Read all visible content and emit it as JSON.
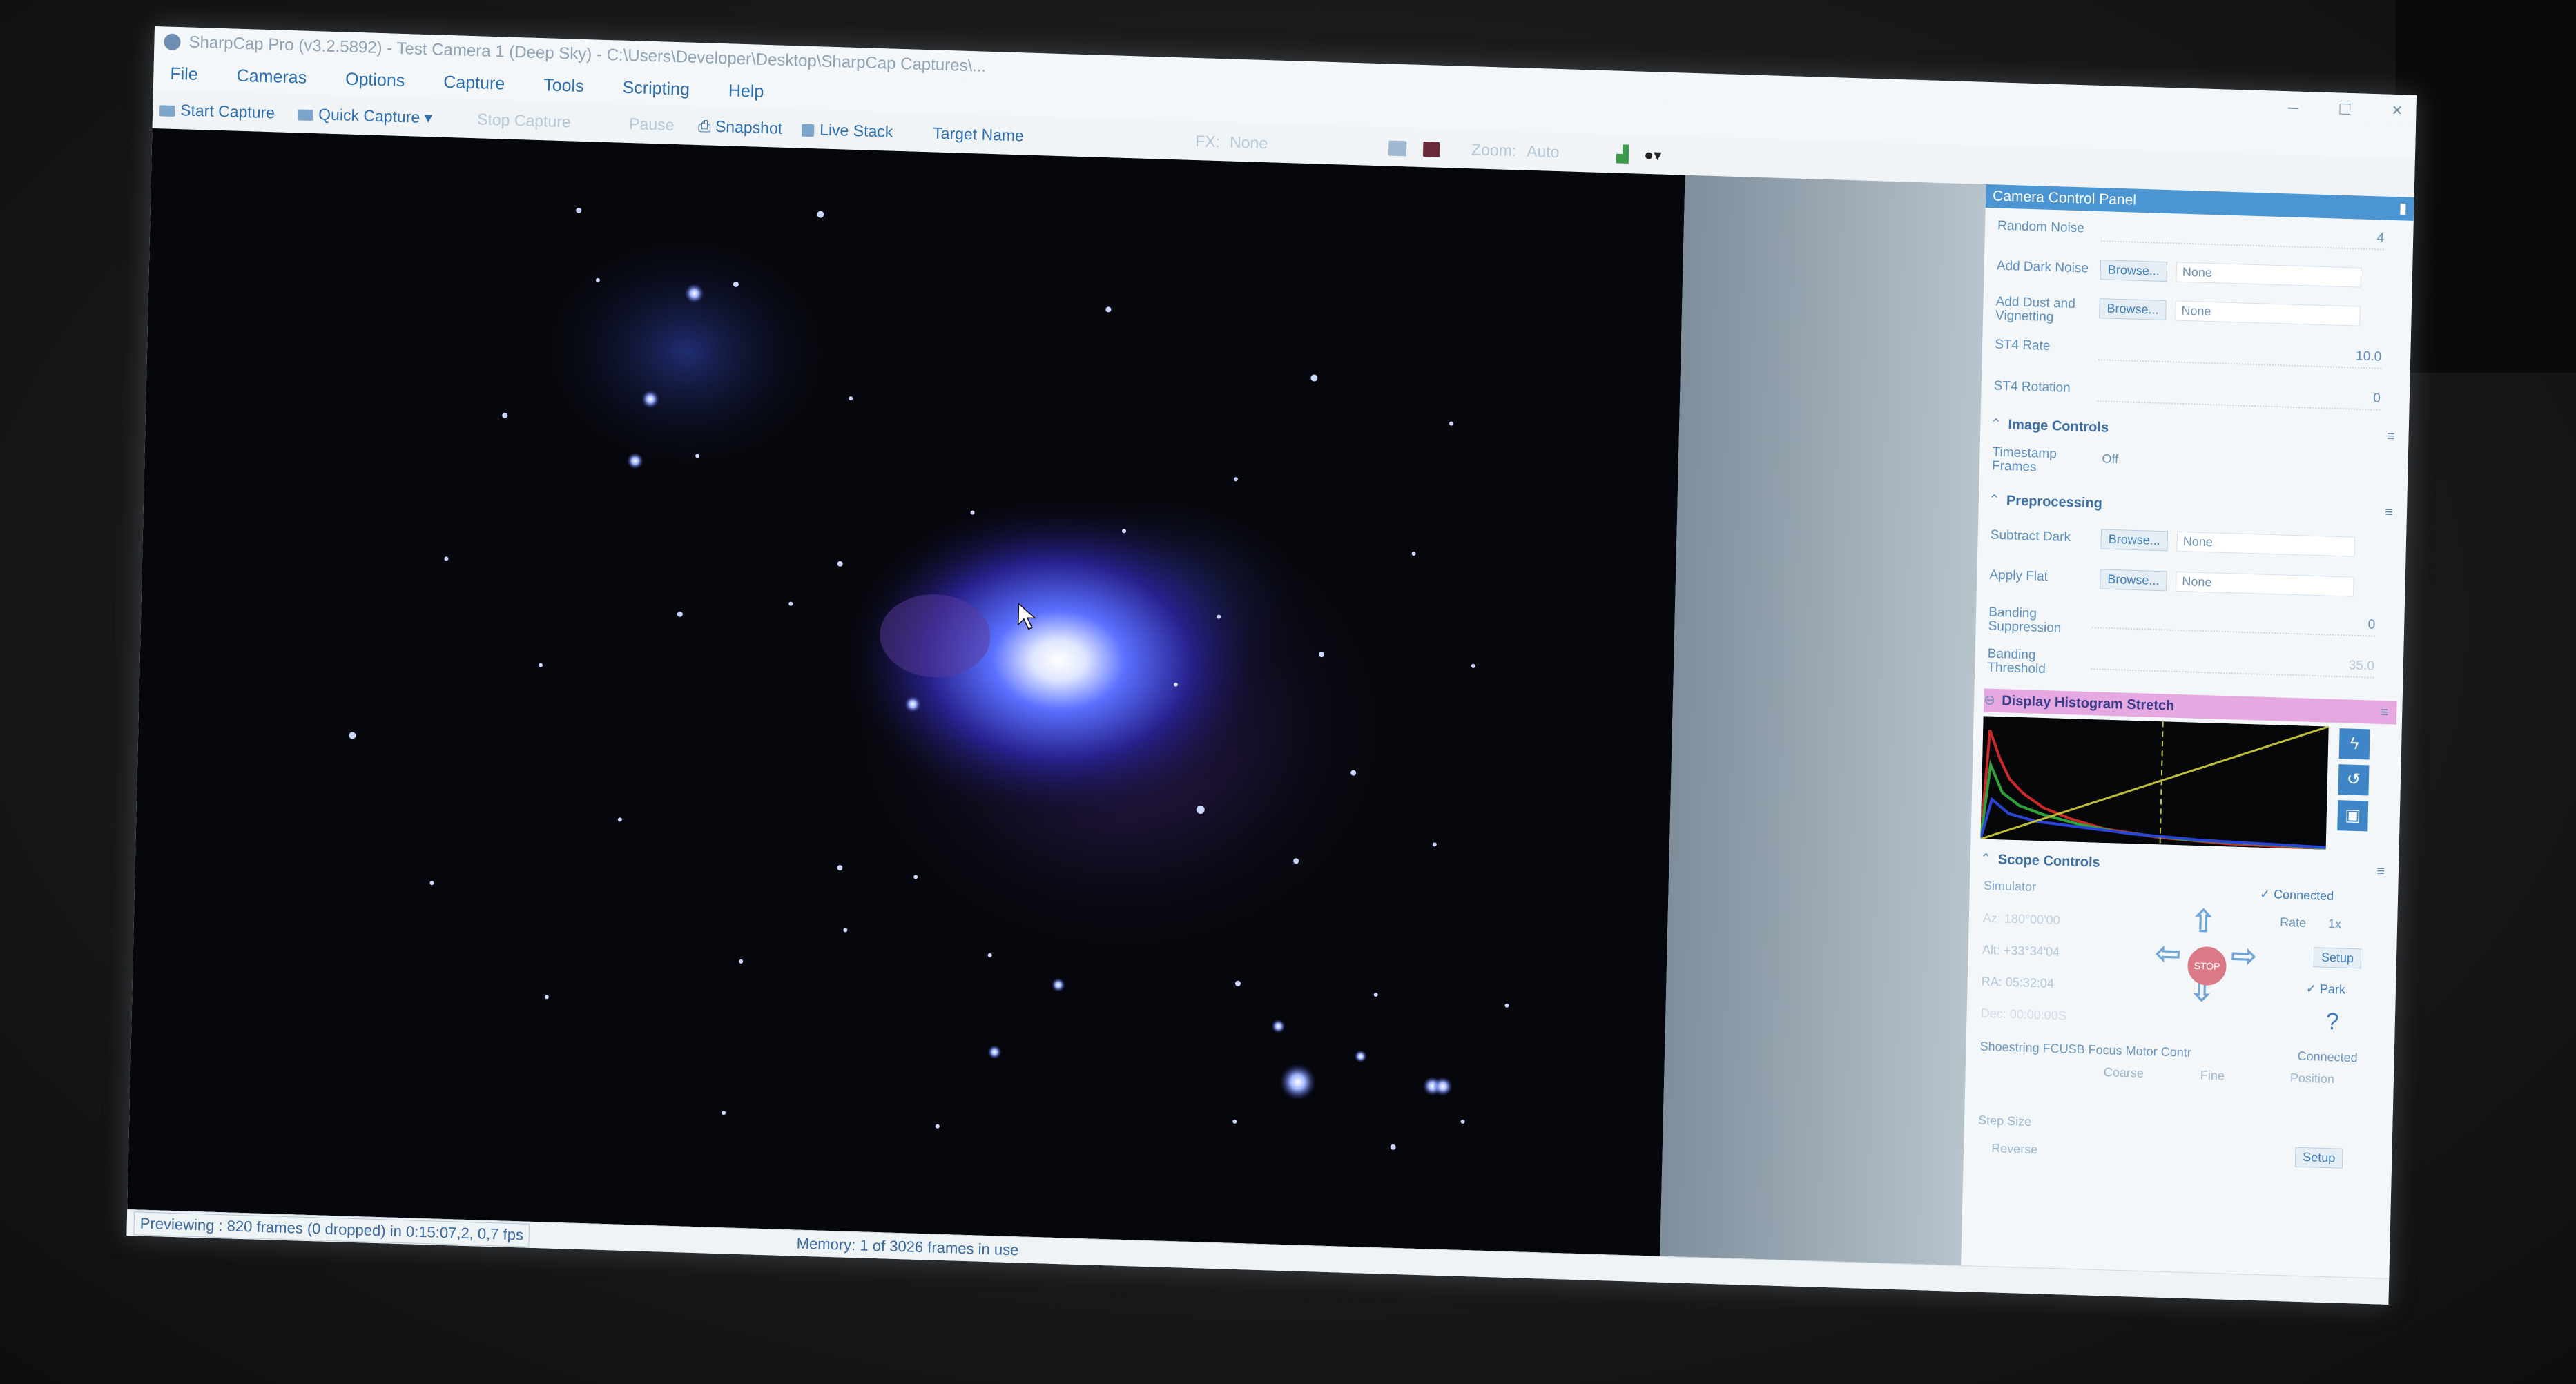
{
  "window": {
    "title": "SharpCap Pro (v3.2.5892) - Test Camera 1 (Deep Sky) - C:\\Users\\Developer\\Desktop\\SharpCap Captures\\...",
    "minimize_label": "–",
    "maximize_label": "□",
    "close_label": "×"
  },
  "menu": [
    "File",
    "Cameras",
    "Options",
    "Capture",
    "Tools",
    "Scripting",
    "Help"
  ],
  "toolbar": {
    "start_capture": "Start Capture",
    "quick_capture": "Quick Capture",
    "stop_capture": "Stop Capture",
    "pause": "Pause",
    "snapshot": "Snapshot",
    "live_stack": "Live Stack",
    "target_name": "Target Name",
    "fx_label": "FX:",
    "fx_value": "None",
    "zoom_label": "Zoom:",
    "zoom_value": "Auto"
  },
  "side_panel": {
    "title": "Camera Control Panel",
    "random_noise": {
      "label": "Random Noise",
      "value": "4"
    },
    "add_dark_noise": {
      "label": "Add Dark Noise",
      "browse": "Browse...",
      "value": "None"
    },
    "add_dust": {
      "label": "Add Dust and Vignetting",
      "browse": "Browse...",
      "value": "None"
    },
    "st4_rate": {
      "label": "ST4 Rate",
      "value": "10.0"
    },
    "st4_rotation": {
      "label": "ST4 Rotation",
      "value": "0"
    },
    "image_controls": {
      "title": "Image Controls",
      "timestamp_label": "Timestamp Frames",
      "timestamp_value": "Off"
    },
    "preprocessing": {
      "title": "Preprocessing",
      "subtract_dark_label": "Subtract Dark",
      "subtract_dark_browse": "Browse...",
      "subtract_dark_value": "None",
      "apply_flat_label": "Apply Flat",
      "apply_flat_browse": "Browse...",
      "apply_flat_value": "None",
      "banding_suppression_label": "Banding Suppression",
      "banding_suppression_value": "0",
      "banding_threshold_label": "Banding Threshold",
      "banding_threshold_value": "35.0"
    },
    "histogram": {
      "title": "Display Histogram Stretch"
    },
    "scope": {
      "title": "Scope Controls",
      "driver": "Simulator",
      "connected": "Connected",
      "az": "Az:  180°00'00",
      "alt": "Alt:  +33°34'04",
      "ra": "RA:  05:32:04",
      "dec": "Dec:  00:00:00S",
      "rate_label": "Rate",
      "rate_value": "1x",
      "setup": "Setup",
      "park": "Park",
      "stop": "STOP",
      "help": "?",
      "focuser": "Shoestring FCUSB Focus Motor Contr",
      "focuser_connected": "Connected",
      "coarse": "Coarse",
      "fine": "Fine",
      "position": "Position",
      "step_size_label": "Step Size",
      "reverse": "Reverse",
      "setup2": "Setup"
    }
  },
  "status": {
    "previewing": "Previewing : 820 frames (0 dropped) in 0:15:07,2, 0,7 fps",
    "memory": "Memory: 1 of 3026 frames in use"
  },
  "colors": {
    "accent": "#4a95d2",
    "histogram_section": "#e6a8e0",
    "stop_button": "#d97a86"
  }
}
